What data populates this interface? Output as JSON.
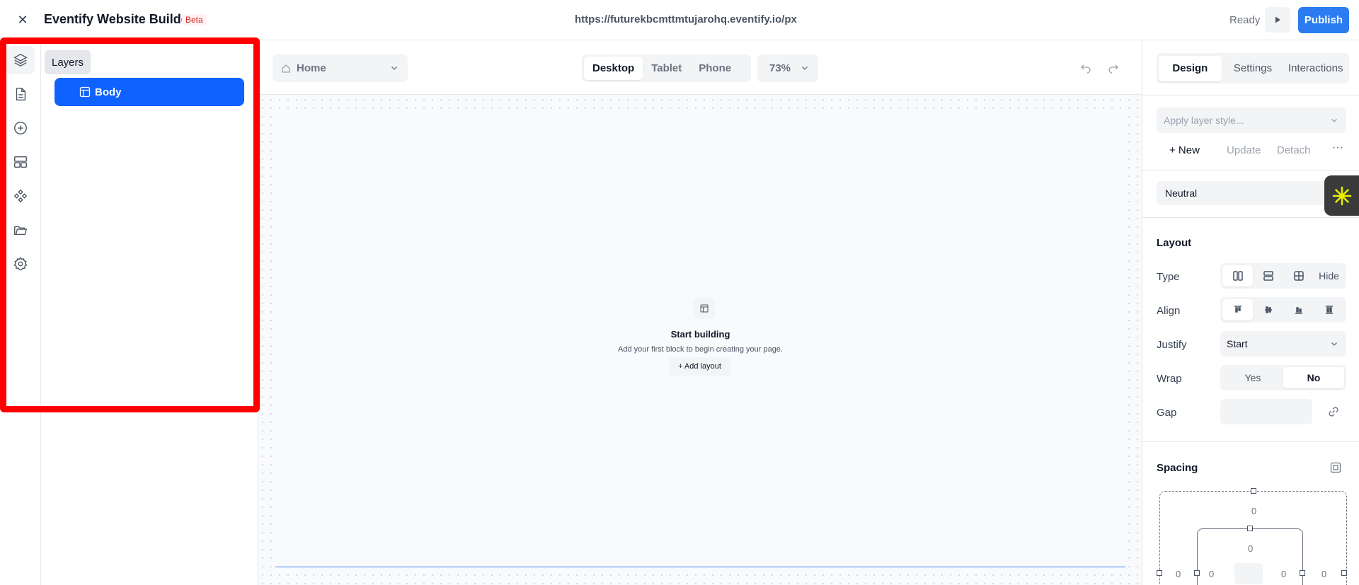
{
  "header": {
    "title": "Eventify Website Builder",
    "badge": "Beta",
    "url": "https://futurekbcmttmtujarohq.eventify.io/px",
    "status": "Ready",
    "publish_label": "Publish"
  },
  "rail": {
    "tooltip": "Layers",
    "items": [
      "layers-icon",
      "page-icon",
      "add-icon",
      "layout-icon",
      "components-icon",
      "folder-icon",
      "settings-icon"
    ]
  },
  "layers": {
    "items": [
      {
        "label": "Body"
      }
    ]
  },
  "canvas_toolbar": {
    "page": "Home",
    "devices": [
      "Desktop",
      "Tablet",
      "Phone"
    ],
    "active_device": "Desktop",
    "zoom": "73%"
  },
  "canvas": {
    "empty_title": "Start building",
    "empty_subtitle": "Add your first block to begin creating your page.",
    "add_layout_label": "+ Add layout"
  },
  "inspector": {
    "tabs": [
      "Design",
      "Settings",
      "Interactions"
    ],
    "active_tab": "Design",
    "layer_style_placeholder": "Apply layer style...",
    "style_actions": {
      "new": "+ New",
      "update": "Update",
      "detach": "Detach",
      "more": "···"
    },
    "theme": "Neutral",
    "layout": {
      "title": "Layout",
      "type_label": "Type",
      "hide_label": "Hide",
      "align_label": "Align",
      "justify_label": "Justify",
      "justify_value": "Start",
      "wrap_label": "Wrap",
      "wrap_yes": "Yes",
      "wrap_no": "No",
      "wrap_value": "No",
      "gap_label": "Gap"
    },
    "spacing": {
      "title": "Spacing",
      "margin_top": "0",
      "padding_top": "0",
      "margin_left": "0",
      "padding_left": "0",
      "padding_right": "0",
      "margin_right": "0"
    }
  },
  "colors": {
    "accent": "#2b7cf0",
    "selected_layer": "#0f62fe",
    "highlight": "#ff0000",
    "beta": "#dc2626"
  }
}
